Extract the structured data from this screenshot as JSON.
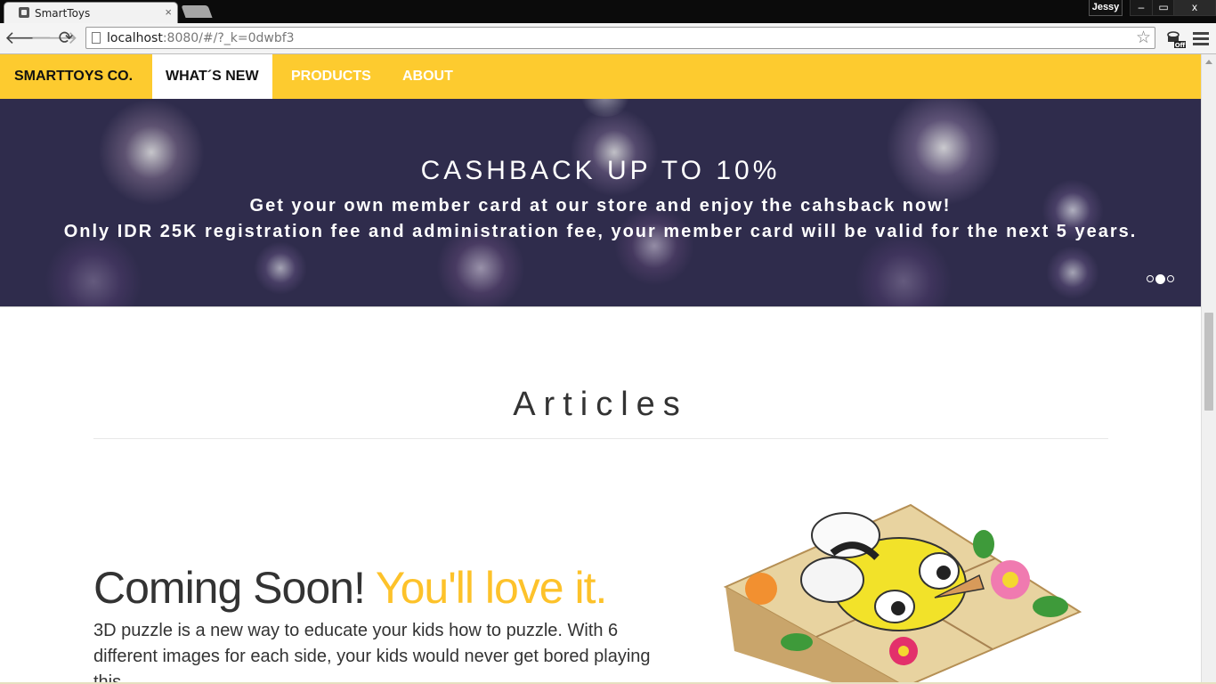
{
  "browser": {
    "tab_title": "SmartToys",
    "tab_close": "×",
    "user_name": "Jessy",
    "window_controls": [
      "–",
      "▭",
      "x"
    ],
    "url_host": "localhost",
    "url_rest": ":8080/#/?_k=0dwbf3"
  },
  "nav": {
    "brand": "SMARTTOYS CO.",
    "items": [
      {
        "label": "WHAT´S NEW",
        "active": true
      },
      {
        "label": "PRODUCTS",
        "active": false
      },
      {
        "label": "ABOUT",
        "active": false
      }
    ]
  },
  "carousel": {
    "title": "CASHBACK UP TO 10%",
    "line1": "Get your own member card at our store and enjoy the cahsback now!",
    "line2": "Only IDR 25K registration fee and administration fee, your member card will be valid for the next 5 years.",
    "slide_count": 3,
    "active_slide": 2
  },
  "articles": {
    "heading": "Articles",
    "title_main": "Coming Soon!",
    "title_accent": "You'll love it.",
    "body": "3D puzzle is a new way to educate your kids how to puzzle. With 6 different images for each side, your kids would never get bored playing this."
  },
  "colors": {
    "nav_yellow": "#fdcb2f",
    "accent_yellow": "#fdc22a",
    "carousel_bg": "#2f2c4c"
  }
}
